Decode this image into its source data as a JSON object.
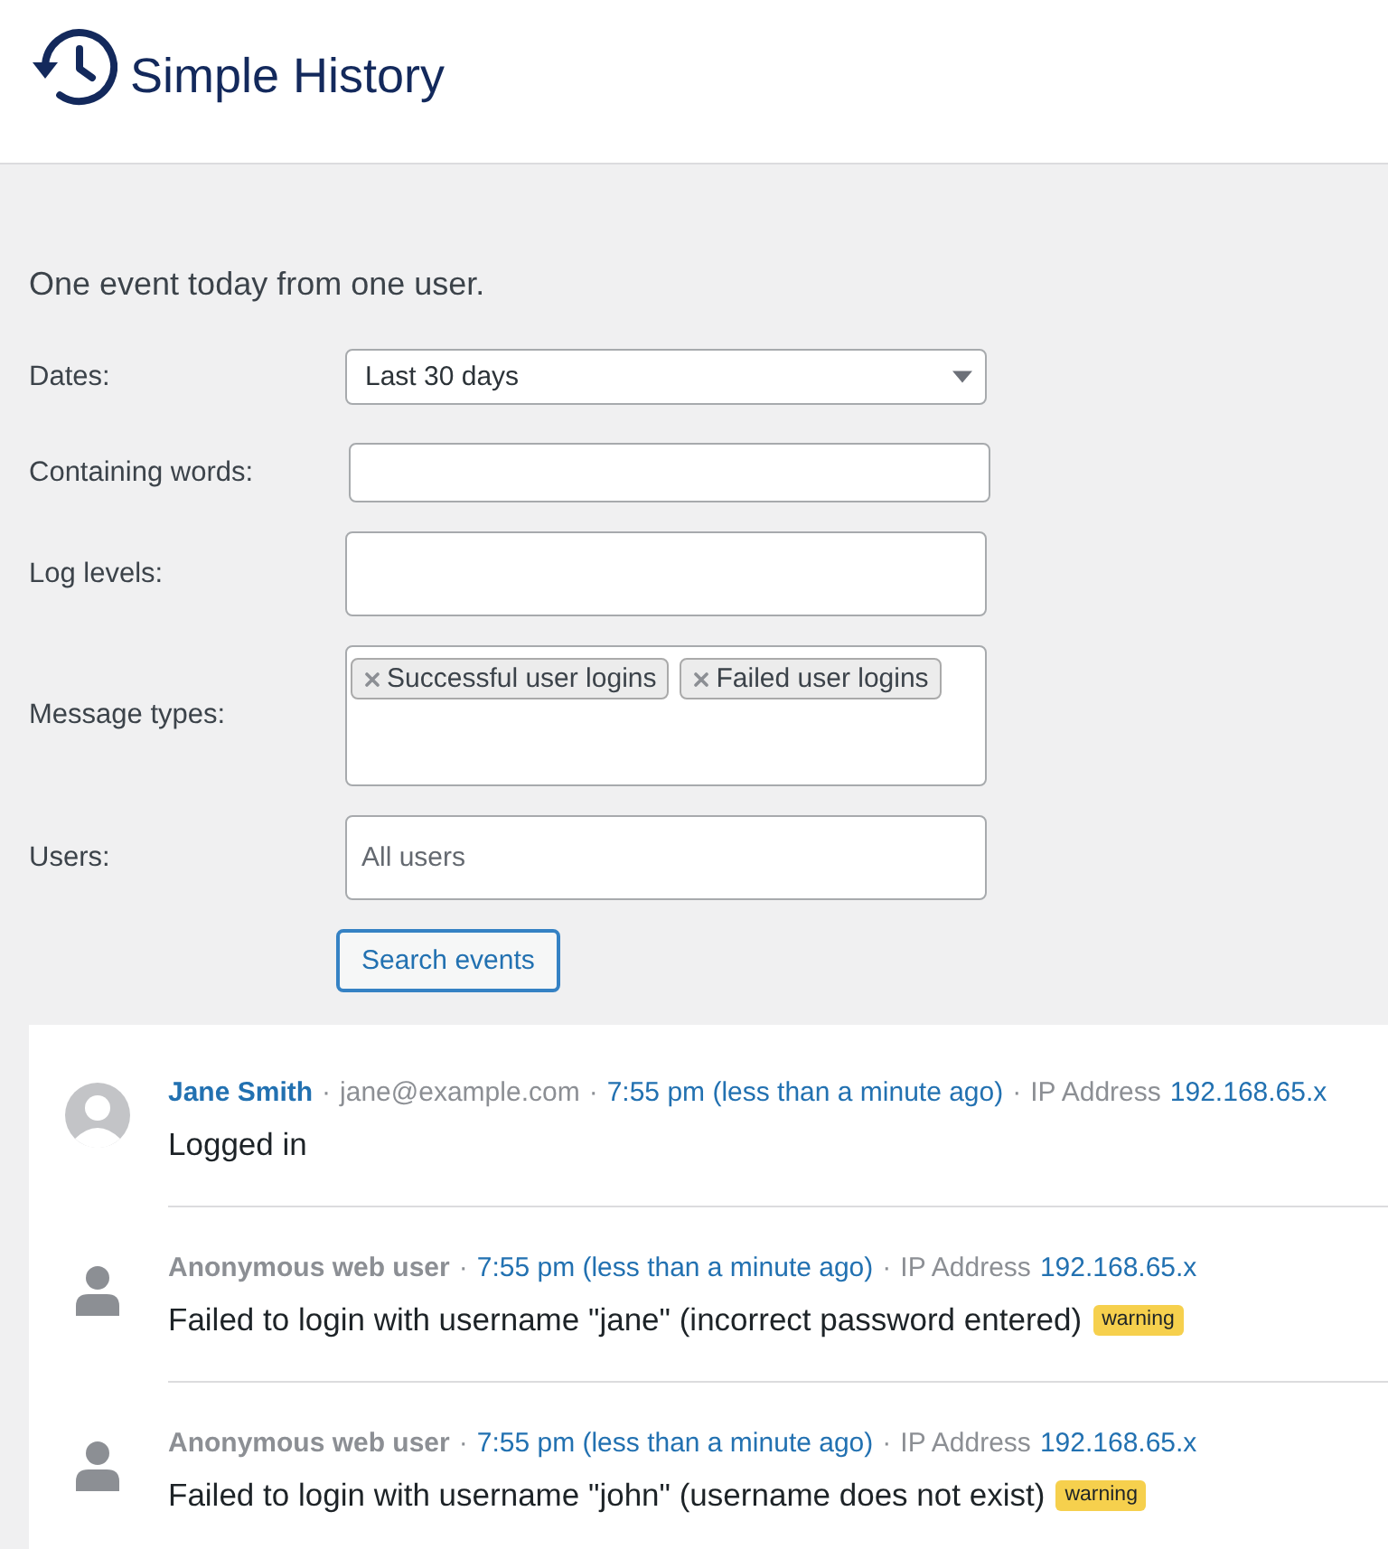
{
  "header": {
    "title": "Simple History"
  },
  "summary": "One event today from one user.",
  "filters": [
    {
      "kind": "select",
      "label": "Dates:",
      "value": "Last 30 days"
    },
    {
      "kind": "text",
      "label": "Containing words:"
    },
    {
      "kind": "multi",
      "label": "Log levels:"
    },
    {
      "kind": "multi",
      "label": "Message types:",
      "tags": [
        "Successful user logins",
        "Failed user logins"
      ]
    },
    {
      "kind": "multi",
      "label": "Users:",
      "placeholder": "All users"
    }
  ],
  "search_button": "Search events",
  "events": [
    {
      "kind": "user",
      "meta": [
        {
          "kind": "user_link",
          "text": "Jane Smith"
        },
        {
          "kind": "separator",
          "text": "·"
        },
        {
          "kind": "email",
          "text": "jane@example.com"
        },
        {
          "kind": "separator",
          "text": "·"
        },
        {
          "kind": "time",
          "text": "7:55 pm (less than a minute ago)"
        },
        {
          "kind": "separator",
          "text": "·"
        },
        {
          "kind": "label",
          "text": "IP Address"
        },
        {
          "kind": "ip",
          "text": "192.168.65.x"
        }
      ],
      "message": "Logged in"
    },
    {
      "kind": "anonymous",
      "meta": [
        {
          "kind": "user",
          "text": "Anonymous web user"
        },
        {
          "kind": "separator",
          "text": "·"
        },
        {
          "kind": "time",
          "text": "7:55 pm (less than a minute ago)"
        },
        {
          "kind": "separator",
          "text": "·"
        },
        {
          "kind": "label",
          "text": "IP Address"
        },
        {
          "kind": "ip",
          "text": "192.168.65.x"
        }
      ],
      "message": "Failed to login with username \"jane\" (incorrect password entered)",
      "badge": "warning"
    },
    {
      "kind": "anonymous",
      "meta": [
        {
          "kind": "user",
          "text": "Anonymous web user"
        },
        {
          "kind": "separator",
          "text": "·"
        },
        {
          "kind": "time",
          "text": "7:55 pm (less than a minute ago)"
        },
        {
          "kind": "separator",
          "text": "·"
        },
        {
          "kind": "label",
          "text": "IP Address"
        },
        {
          "kind": "ip",
          "text": "192.168.65.x"
        }
      ],
      "message": "Failed to login with username \"john\" (username does not exist)",
      "badge": "warning"
    }
  ]
}
